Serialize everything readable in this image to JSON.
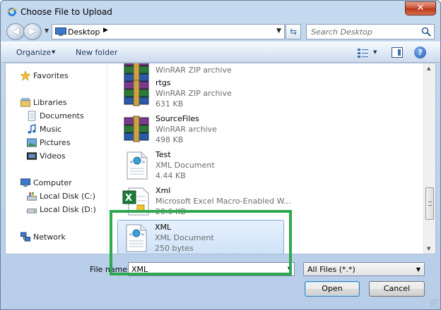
{
  "window": {
    "title": "Choose File to Upload",
    "close_label": "✕"
  },
  "navbar": {
    "address_path": "Desktop",
    "search_placeholder": "Search Desktop"
  },
  "toolbar": {
    "organize_label": "Organize",
    "new_folder_label": "New folder"
  },
  "nav_pane": {
    "items": [
      {
        "label": "Favorites",
        "icon": "star-icon"
      },
      {
        "label": "Libraries",
        "icon": "libraries-icon"
      },
      {
        "label": "Documents",
        "icon": "documents-icon"
      },
      {
        "label": "Music",
        "icon": "music-icon"
      },
      {
        "label": "Pictures",
        "icon": "pictures-icon"
      },
      {
        "label": "Videos",
        "icon": "videos-icon"
      },
      {
        "label": "Computer",
        "icon": "computer-icon"
      },
      {
        "label": "Local Disk (C:)",
        "icon": "drive-icon"
      },
      {
        "label": "Local Disk (D:)",
        "icon": "drive-icon"
      },
      {
        "label": "Network",
        "icon": "network-icon"
      }
    ]
  },
  "files": [
    {
      "name": "",
      "type": "WinRAR ZIP archive",
      "size": "",
      "icon": "winrar-archive-icon"
    },
    {
      "name": "rtgs",
      "type": "WinRAR ZIP archive",
      "size": "631 KB",
      "icon": "winrar-archive-icon"
    },
    {
      "name": "SourceFiles",
      "type": "WinRAR archive",
      "size": "498 KB",
      "icon": "winrar-archive-icon"
    },
    {
      "name": "Test",
      "type": "XML Document",
      "size": "4.44 KB",
      "icon": "xml-document-icon"
    },
    {
      "name": "Xml",
      "type": "Microsoft Excel Macro-Enabled W...",
      "size": "20.6 KB",
      "icon": "excel-macro-icon"
    },
    {
      "name": "XML",
      "type": "XML Document",
      "size": "250 bytes",
      "icon": "xml-document-icon",
      "selected": true
    }
  ],
  "bottom": {
    "file_name_label": "File name:",
    "file_name_value": "XML",
    "file_type_value": "All Files (*.*)",
    "open_label": "Open",
    "cancel_label": "Cancel"
  },
  "colors": {
    "highlight_border": "#2fa84f",
    "selection_fill": "#cfe2f8"
  }
}
